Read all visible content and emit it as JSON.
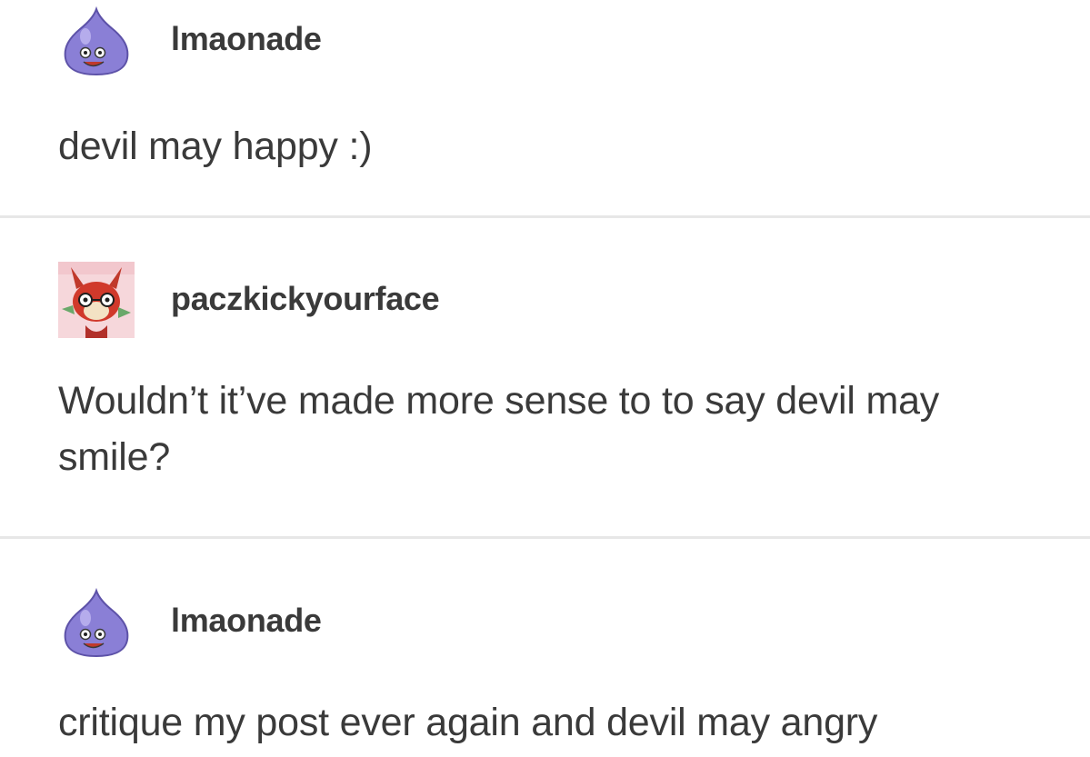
{
  "posts": [
    {
      "username": "lmaonade",
      "avatar_icon": "purple-slime-icon",
      "text": "devil may happy :)"
    },
    {
      "username": "paczkickyourface",
      "avatar_icon": "red-fox-character-icon",
      "text": "Wouldn’t it’ve made more sense to to say devil may smile?"
    },
    {
      "username": "lmaonade",
      "avatar_icon": "purple-slime-icon",
      "text": "critique my post ever again and devil may angry"
    }
  ],
  "colors": {
    "text": "#3a3a3a",
    "divider": "#e7e7e7",
    "slime": "#8a7fd6"
  }
}
